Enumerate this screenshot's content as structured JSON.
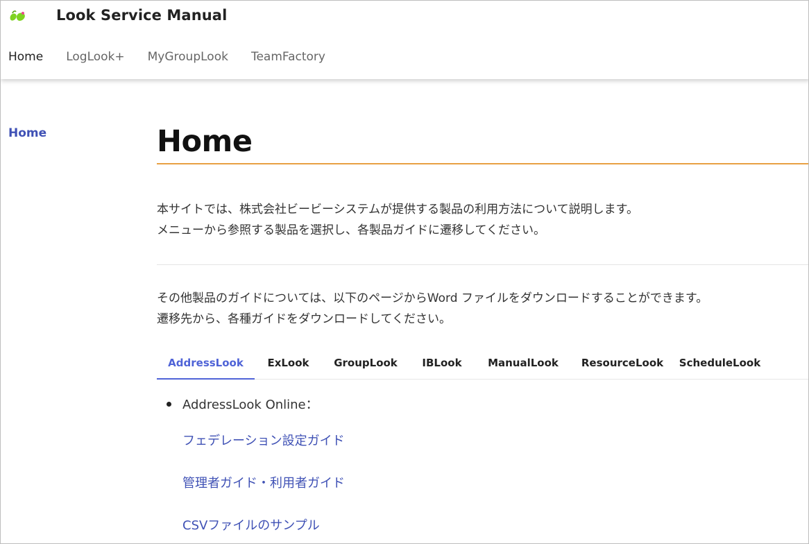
{
  "header": {
    "logo_icon": "bb-logo-icon",
    "brand_colors": [
      "#7ed321",
      "#e94b8a"
    ],
    "site_title": "Look Service Manual",
    "nav": [
      {
        "label": "Home",
        "active": true
      },
      {
        "label": "LogLook+",
        "active": false
      },
      {
        "label": "MyGroupLook",
        "active": false
      },
      {
        "label": "TeamFactory",
        "active": false
      }
    ]
  },
  "sidebar": {
    "items": [
      {
        "label": "Home"
      }
    ],
    "link_color": "#3f51b5"
  },
  "main": {
    "title": "Home",
    "title_rule_color": "#e8a042",
    "intro": [
      "本サイトでは、株式会社ビービーシステムが提供する製品の利用方法について説明します。",
      "メニューから参照する製品を選択し、各製品ガイドに遷移してください。"
    ],
    "other": [
      "その他製品のガイドについては、以下のページからWord ファイルをダウンロードすることができます。",
      "遷移先から、各種ガイドをダウンロードしてください。"
    ],
    "tabs": [
      {
        "label": "AddressLook",
        "active": true
      },
      {
        "label": "ExLook",
        "active": false
      },
      {
        "label": "GroupLook",
        "active": false
      },
      {
        "label": "IBLook",
        "active": false
      },
      {
        "label": "ManualLook",
        "active": false
      },
      {
        "label": "ResourceLook",
        "active": false
      },
      {
        "label": "ScheduleLook",
        "active": false
      }
    ],
    "active_tab_color": "#4f63d7",
    "tab_content": {
      "bullet": "AddressLook Online：",
      "links": [
        "フェデレーション設定ガイド",
        "管理者ガイド・利用者ガイド",
        "CSVファイルのサンプル"
      ]
    }
  }
}
